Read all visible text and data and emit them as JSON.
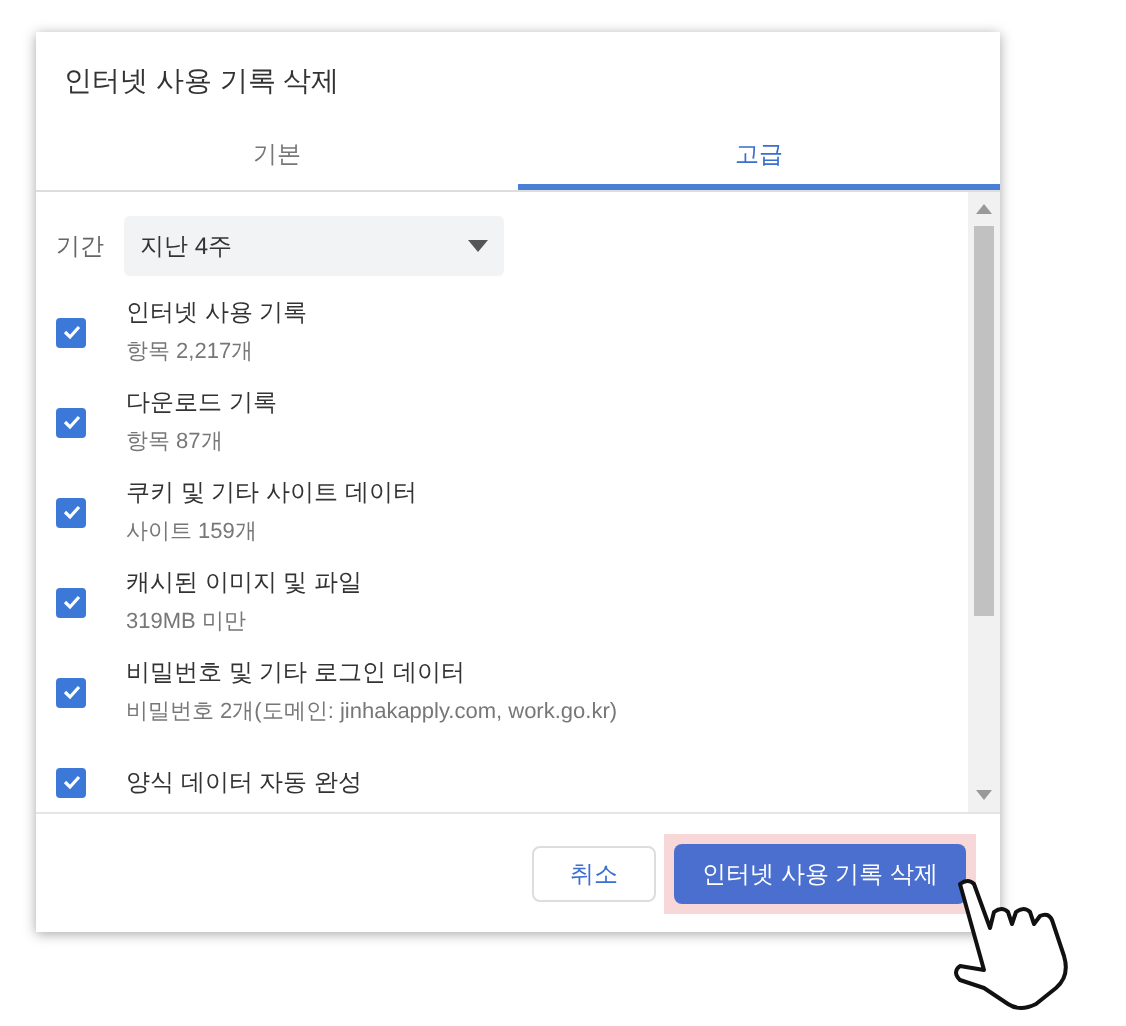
{
  "dialog": {
    "title": "인터넷 사용 기록 삭제"
  },
  "tabs": [
    {
      "label": "기본",
      "selected": false
    },
    {
      "label": "고급",
      "selected": true
    }
  ],
  "period": {
    "label": "기간",
    "value": "지난 4주"
  },
  "items": [
    {
      "title": "인터넷 사용 기록",
      "detail": "항목 2,217개",
      "checked": true
    },
    {
      "title": "다운로드 기록",
      "detail": "항목 87개",
      "checked": true
    },
    {
      "title": "쿠키 및 기타 사이트 데이터",
      "detail": "사이트 159개",
      "checked": true
    },
    {
      "title": "캐시된 이미지 및 파일",
      "detail": "319MB 미만",
      "checked": true
    },
    {
      "title": "비밀번호 및 기타 로그인 데이터",
      "detail": "비밀번호 2개(도메인: jinhakapply.com, work.go.kr)",
      "checked": true
    },
    {
      "title": "양식 데이터 자동 완성",
      "checked": true
    }
  ],
  "buttons": {
    "cancel": "취소",
    "confirm": "인터넷 사용 기록 삭제"
  }
}
